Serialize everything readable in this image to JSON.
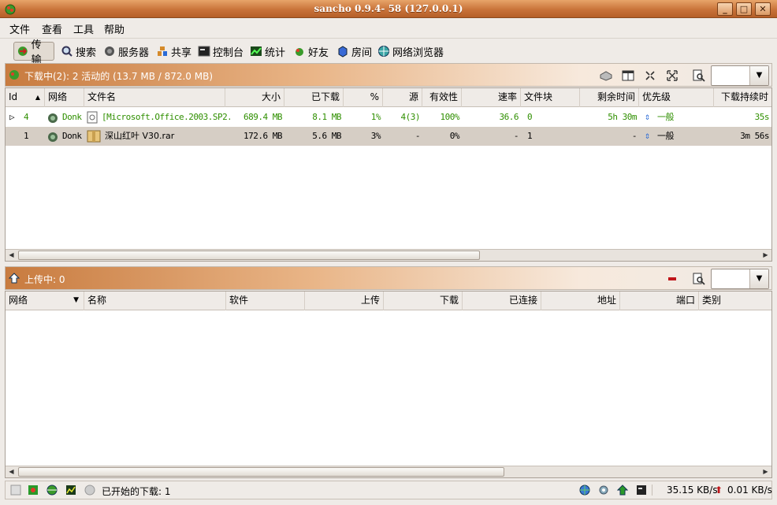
{
  "window": {
    "title": "sancho 0.9.4- 58 (127.0.0.1)",
    "buttons": [
      "_",
      "□",
      "✕"
    ]
  },
  "menu": [
    "文件",
    "查看",
    "工具",
    "帮助"
  ],
  "toolbar": [
    {
      "label": "传输",
      "icon": "transfer-icon"
    },
    {
      "label": "搜索",
      "icon": "search-icon"
    },
    {
      "label": "服务器",
      "icon": "server-icon"
    },
    {
      "label": "共享",
      "icon": "share-icon"
    },
    {
      "label": "控制台",
      "icon": "console-icon"
    },
    {
      "label": "统计",
      "icon": "stats-icon"
    },
    {
      "label": "好友",
      "icon": "friends-icon"
    },
    {
      "label": "房间",
      "icon": "rooms-icon"
    },
    {
      "label": "网络浏览器",
      "icon": "web-browser-icon"
    }
  ],
  "downloads": {
    "header": "下载中(2): 2 活动的 (13.7 MB / 872.0 MB)",
    "columns": [
      "Id",
      "网络",
      "文件名",
      "大小",
      "已下载",
      "%",
      "源",
      "有效性",
      "速率",
      "文件块",
      "剩余时间",
      "优先级",
      "下载持续时"
    ],
    "rows": [
      {
        "id": "4",
        "network": "Donk",
        "name": "[Microsoft.Office.2003.SP2.",
        "size": "689.4 MB",
        "downloaded": "8.1 MB",
        "percent": "1%",
        "sources": "4(3)",
        "availability": "100%",
        "rate": "36.6",
        "chunks": "0",
        "remaining": "5h 30m",
        "priority": "一般",
        "duration": "35s"
      },
      {
        "id": "1",
        "network": "Donk",
        "name": "深山红叶 V30.rar",
        "size": "172.6 MB",
        "downloaded": "5.6 MB",
        "percent": "3%",
        "sources": "-",
        "availability": "0%",
        "rate": "-",
        "chunks": "1",
        "remaining": "-",
        "priority": "一般",
        "duration": "3m 56s"
      }
    ]
  },
  "uploads": {
    "header": "上传中: 0",
    "columns": [
      "网络",
      "名称",
      "软件",
      "上传",
      "下载",
      "已连接",
      "地址",
      "端口",
      "类别"
    ]
  },
  "status": {
    "text": "已开始的下载: 1",
    "down_rate": "35.15 KB/s",
    "up_rate": "0.01 KB/s"
  }
}
